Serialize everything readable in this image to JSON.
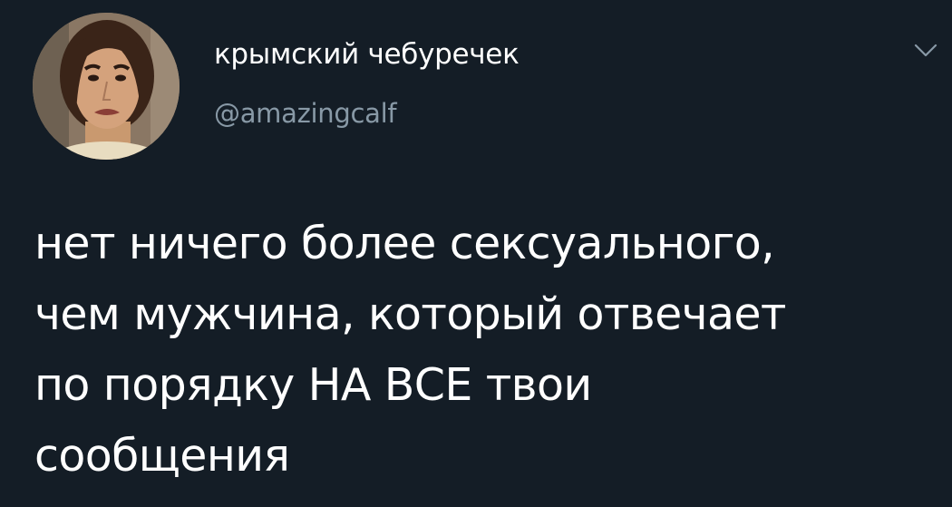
{
  "tweet": {
    "author": {
      "display_name": "крымский чебуречек",
      "handle": "@amazingcalf",
      "avatar_icon": "profile-photo"
    },
    "menu_icon": "chevron-down-icon",
    "text_lines": [
      "нет ничего более сексуального,",
      "чем мужчина, который отвечает",
      "по порядку НА ВСЕ твои",
      "сообщения"
    ]
  },
  "colors": {
    "background": "#141d26",
    "text": "#ffffff",
    "secondary_text": "#8899a6"
  }
}
